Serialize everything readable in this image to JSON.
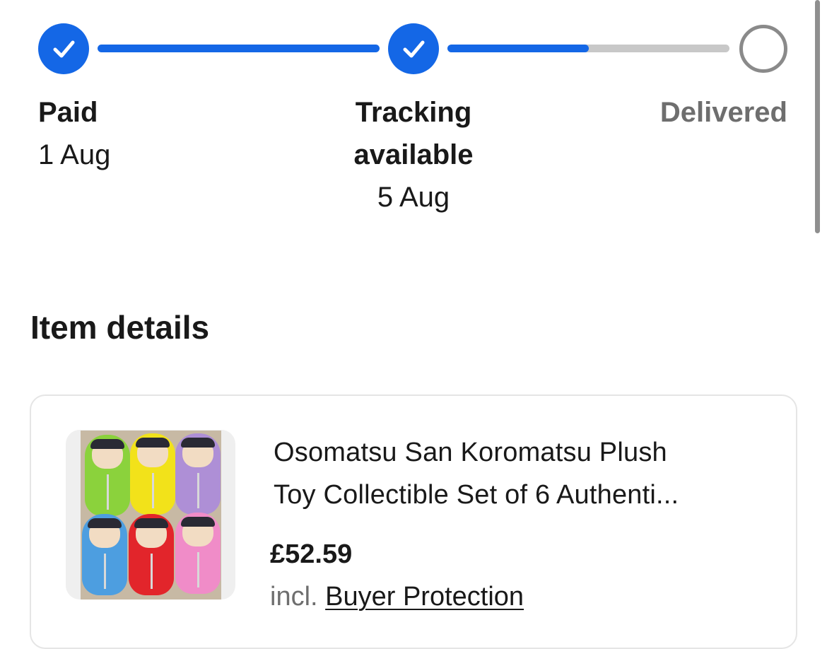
{
  "progress": {
    "steps": [
      {
        "label": "Paid",
        "date": "1 Aug",
        "state": "complete",
        "icon": "check-icon"
      },
      {
        "label_line1": "Tracking",
        "label_line2": "available",
        "date": "5 Aug",
        "state": "complete",
        "icon": "check-icon"
      },
      {
        "label": "Delivered",
        "date": "",
        "state": "pending",
        "icon": "empty-circle-icon"
      }
    ],
    "segment_fill": [
      1.0,
      0.5
    ],
    "colors": {
      "complete": "#1467e6",
      "pending": "#8a8a8a",
      "track_bg": "#c8c8c8"
    }
  },
  "item_details": {
    "heading": "Item details",
    "item": {
      "title_line1": "Osomatsu San Koromatsu Plush",
      "title_line2": "Toy Collectible Set of 6 Authenti...",
      "price": "£52.59",
      "price_note_prefix": "incl.",
      "price_note_link": "Buyer Protection",
      "image": "product-photo-plush-set"
    }
  }
}
